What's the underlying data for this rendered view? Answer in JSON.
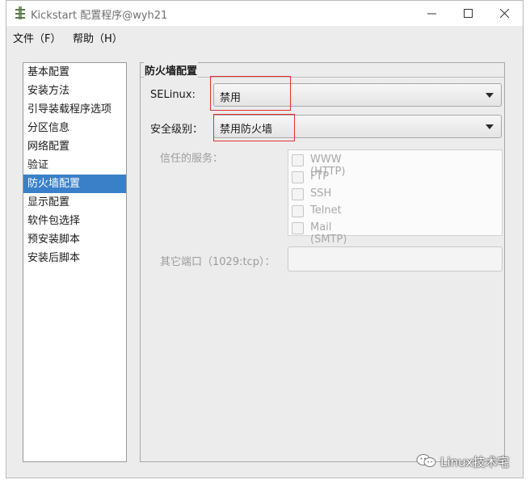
{
  "window": {
    "title": "Kickstart 配置程序@wyh21"
  },
  "menu": {
    "file": "文件（F）",
    "help": "帮助（H）"
  },
  "sidebar": {
    "items": [
      {
        "label": "基本配置"
      },
      {
        "label": "安装方法"
      },
      {
        "label": "引导装载程序选项"
      },
      {
        "label": "分区信息"
      },
      {
        "label": "网络配置"
      },
      {
        "label": "验证"
      },
      {
        "label": "防火墙配置",
        "active": true
      },
      {
        "label": "显示配置"
      },
      {
        "label": "软件包选择"
      },
      {
        "label": "预安装脚本"
      },
      {
        "label": "安装后脚本"
      }
    ]
  },
  "firewall": {
    "section_title": "防火墙配置",
    "selinux_label": "SELinux:",
    "selinux_value": "禁用",
    "security_level_label": "安全级别：",
    "security_level_value": "禁用防火墙",
    "trusted_services_label": "信任的服务：",
    "services": [
      {
        "label": "WWW (HTTP)",
        "checked": false
      },
      {
        "label": "FTP",
        "checked": false
      },
      {
        "label": "SSH",
        "checked": false
      },
      {
        "label": "Telnet",
        "checked": false
      },
      {
        "label": "Mail (SMTP)",
        "checked": false
      }
    ],
    "other_ports_label": "其它端口（1029:tcp）：",
    "other_ports_value": ""
  },
  "watermark": {
    "text": "Linux技术宅"
  },
  "colors": {
    "selection": "#3a80c9",
    "annotation_box": "#e03030",
    "window_bg": "#ececec"
  }
}
